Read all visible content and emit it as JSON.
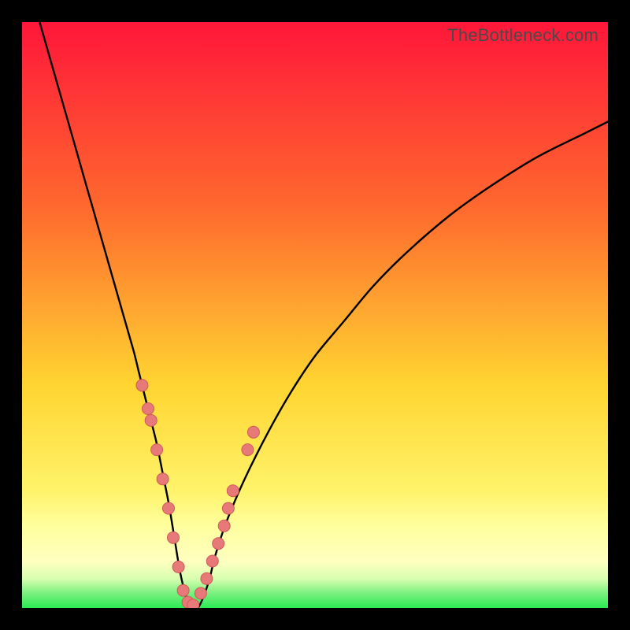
{
  "watermark": "TheBottleneck.com",
  "colors": {
    "bg_black": "#000000",
    "grad_top": "#ff163a",
    "grad_mid1": "#ff6a2e",
    "grad_mid2": "#ffd531",
    "grad_band": "#ffff9e",
    "grad_green": "#2bea55",
    "curve": "#000000",
    "dot_fill": "#e77a78",
    "dot_stroke": "#cf5a58"
  },
  "chart_data": {
    "type": "line",
    "title": "",
    "xlabel": "",
    "ylabel": "",
    "xlim": [
      0,
      100
    ],
    "ylim": [
      0,
      100
    ],
    "series": [
      {
        "name": "bottleneck-curve",
        "x": [
          3,
          5,
          7,
          9,
          11,
          13,
          15,
          17,
          19,
          20,
          21,
          22,
          23,
          24,
          25,
          26,
          27,
          28,
          29,
          30,
          31,
          32,
          33,
          35,
          38,
          42,
          46,
          50,
          55,
          60,
          66,
          73,
          80,
          88,
          96,
          100
        ],
        "y": [
          100,
          93,
          86,
          79,
          72,
          65,
          58,
          51,
          44,
          40,
          36,
          32,
          28,
          23,
          18,
          12,
          6,
          2,
          0,
          0,
          2,
          5,
          9,
          15,
          22,
          30,
          37,
          43,
          49,
          55,
          61,
          67,
          72,
          77,
          81,
          83
        ]
      }
    ],
    "points": {
      "name": "sample-dots",
      "x": [
        20.5,
        21.5,
        22.0,
        23.0,
        24.0,
        25.0,
        25.8,
        26.7,
        27.5,
        28.3,
        29.2,
        30.5,
        31.5,
        32.5,
        33.5,
        34.5,
        35.2,
        36.0,
        38.5,
        39.5
      ],
      "y": [
        38,
        34,
        32,
        27,
        22,
        17,
        12,
        7,
        3,
        1,
        0.5,
        2.5,
        5,
        8,
        11,
        14,
        17,
        20,
        27,
        30
      ]
    }
  }
}
